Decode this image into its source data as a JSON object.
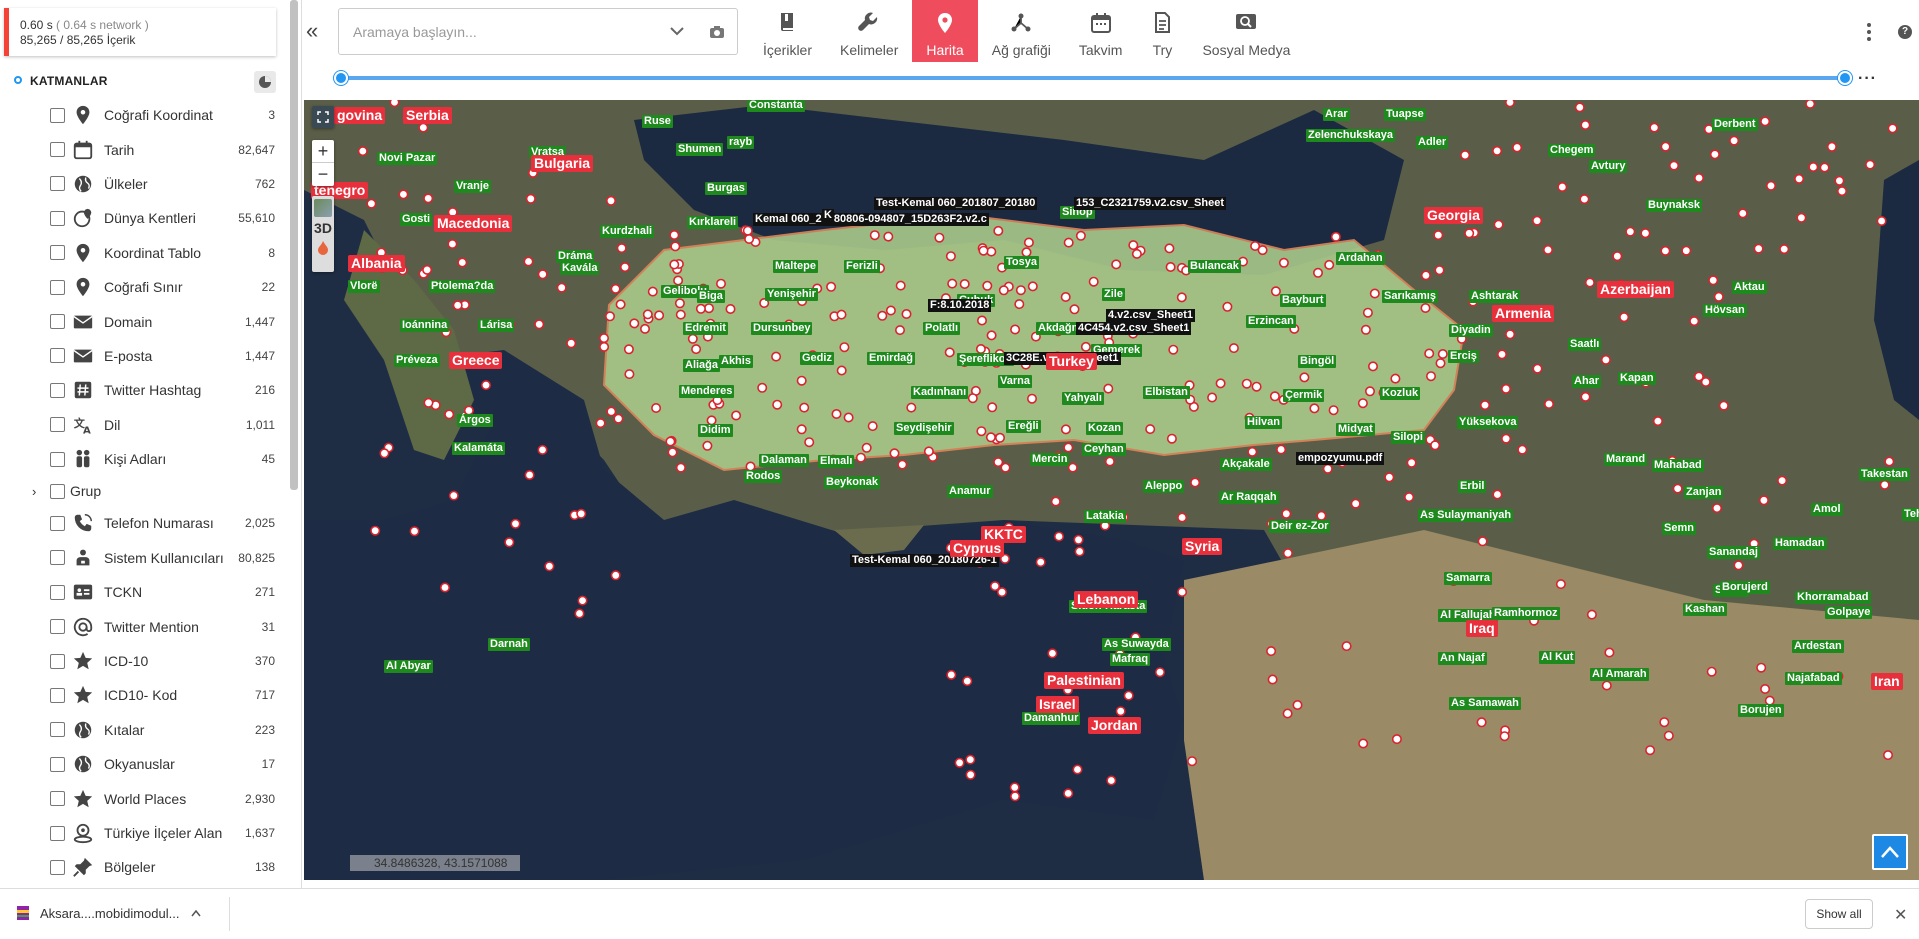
{
  "status": {
    "time": "0.60 s",
    "network": "( 0.64 s network )",
    "count": "85,265 / 85,265 İçerik"
  },
  "layers_title": "KATMANLAR",
  "layers": [
    {
      "label": "Coğrafi Koordinat",
      "count": "3",
      "icon": "pin-icon"
    },
    {
      "label": "Tarih",
      "count": "82,647",
      "icon": "calendar-icon"
    },
    {
      "label": "Ülkeler",
      "count": "762",
      "icon": "globe-icon"
    },
    {
      "label": "Dünya Kentleri",
      "count": "55,610",
      "icon": "globe-pin-icon"
    },
    {
      "label": "Koordinat Tablo",
      "count": "8",
      "icon": "pin-icon"
    },
    {
      "label": "Coğrafi Sınır",
      "count": "22",
      "icon": "pin-icon"
    },
    {
      "label": "Domain",
      "count": "1,447",
      "icon": "mail-icon"
    },
    {
      "label": "E-posta",
      "count": "1,447",
      "icon": "mail-icon"
    },
    {
      "label": "Twitter Hashtag",
      "count": "216",
      "icon": "hashtag-icon"
    },
    {
      "label": "Dil",
      "count": "1,011",
      "icon": "translate-icon"
    },
    {
      "label": "Kişi Adları",
      "count": "45",
      "icon": "people-icon"
    },
    {
      "label": "Grup",
      "count": "",
      "icon": ""
    },
    {
      "label": "Telefon Numarası",
      "count": "2,025",
      "icon": "phone-icon"
    },
    {
      "label": "Sistem Kullanıcıları",
      "count": "80,825",
      "icon": "users-icon"
    },
    {
      "label": "TCKN",
      "count": "271",
      "icon": "id-card-icon"
    },
    {
      "label": "Twitter Mention",
      "count": "31",
      "icon": "at-icon"
    },
    {
      "label": "ICD-10",
      "count": "370",
      "icon": "star-icon"
    },
    {
      "label": "ICD10- Kod",
      "count": "717",
      "icon": "star-icon"
    },
    {
      "label": "Kıtalar",
      "count": "223",
      "icon": "globe-icon"
    },
    {
      "label": "Okyanuslar",
      "count": "17",
      "icon": "globe-icon"
    },
    {
      "label": "World Places",
      "count": "2,930",
      "icon": "star-icon"
    },
    {
      "label": "Türkiye İlçeler Alan",
      "count": "1,637",
      "icon": "map-area-icon"
    },
    {
      "label": "Bölgeler",
      "count": "138",
      "icon": "pushpin-icon"
    }
  ],
  "search": {
    "placeholder": "Aramaya başlayın..."
  },
  "tabs": [
    {
      "label": "İçerikler",
      "icon": "book-icon",
      "active": false
    },
    {
      "label": "Kelimeler",
      "icon": "wrench-icon",
      "active": false
    },
    {
      "label": "Harita",
      "icon": "map-pin-icon",
      "active": true
    },
    {
      "label": "Ağ grafiği",
      "icon": "network-icon",
      "active": false
    },
    {
      "label": "Takvim",
      "icon": "calendar-icon",
      "active": false
    },
    {
      "label": "Try",
      "icon": "document-icon",
      "active": false
    },
    {
      "label": "Sosyal Medya",
      "icon": "image-search-icon",
      "active": false
    }
  ],
  "map": {
    "coordinates": "34.8486328, 43.1571088",
    "map_3d_label": "3D",
    "countries": [
      {
        "t": "Serbia"
      },
      {
        "t": "Bulgaria"
      },
      {
        "t": "tenegro"
      },
      {
        "t": "Macedonia"
      },
      {
        "t": "Albania"
      },
      {
        "t": "Greece"
      },
      {
        "t": "Georgia"
      },
      {
        "t": "Azerbaijan"
      },
      {
        "t": "Armenia"
      },
      {
        "t": "Turkey"
      },
      {
        "t": "KKTC"
      },
      {
        "t": "Cyprus"
      },
      {
        "t": "Syria"
      },
      {
        "t": "Lebanon"
      },
      {
        "t": "Palestinian"
      },
      {
        "t": "Israel"
      },
      {
        "t": "Jordan"
      },
      {
        "t": "Iraq"
      },
      {
        "t": "Iran"
      },
      {
        "t": "govina"
      }
    ],
    "cities": [
      {
        "t": "Constanta"
      },
      {
        "t": "Ruse"
      },
      {
        "t": "Novi Pazar"
      },
      {
        "t": "Vratsa"
      },
      {
        "t": "Shumen"
      },
      {
        "t": "Burgas"
      },
      {
        "t": "Vranje"
      },
      {
        "t": "Gosti"
      },
      {
        "t": "Kurdzhali"
      },
      {
        "t": "Kırklareli"
      },
      {
        "t": "Dráma"
      },
      {
        "t": "Kavála"
      },
      {
        "t": "Vlorë"
      },
      {
        "t": "Ptolema?da"
      },
      {
        "t": "Maltepe"
      },
      {
        "t": "Ferizli"
      },
      {
        "t": "Tosya"
      },
      {
        "t": "Sinop"
      },
      {
        "t": "Bulancak"
      },
      {
        "t": "Ardahan"
      },
      {
        "t": "Gelibolu"
      },
      {
        "t": "Biga"
      },
      {
        "t": "Yenişehir"
      },
      {
        "t": "Çubuk"
      },
      {
        "t": "Zile"
      },
      {
        "t": "Bayburt"
      },
      {
        "t": "Sarıkamış"
      },
      {
        "t": "Ashtarak"
      },
      {
        "t": "Ioánnina"
      },
      {
        "t": "Lárisa"
      },
      {
        "t": "Edremit"
      },
      {
        "t": "Dursunbey"
      },
      {
        "t": "Polatlı"
      },
      {
        "t": "Akdağmadeni"
      },
      {
        "t": "Erzincan"
      },
      {
        "t": "Diyadin"
      },
      {
        "t": "Préveza"
      },
      {
        "t": "Akhis"
      },
      {
        "t": "Gediz"
      },
      {
        "t": "Emirdağ"
      },
      {
        "t": "Şereflikoç"
      },
      {
        "t": "Gemerek"
      },
      {
        "t": "Bingöl"
      },
      {
        "t": "Erciş"
      },
      {
        "t": "Aliağa"
      },
      {
        "t": "Kadınhanı"
      },
      {
        "t": "Yahyalı"
      },
      {
        "t": "Elbistan"
      },
      {
        "t": "Çermik"
      },
      {
        "t": "Kozluk"
      },
      {
        "t": "Menderes"
      },
      {
        "t": "Árgos"
      },
      {
        "t": "Seydişehir"
      },
      {
        "t": "Ereğli"
      },
      {
        "t": "Kozan"
      },
      {
        "t": "Hilvan"
      },
      {
        "t": "Midyat"
      },
      {
        "t": "Silopi"
      },
      {
        "t": "Yüksekova"
      },
      {
        "t": "Didim"
      },
      {
        "t": "Kalamáta"
      },
      {
        "t": "Dalaman"
      },
      {
        "t": "Elmalı"
      },
      {
        "t": "Mercin"
      },
      {
        "t": "Ceyhan"
      },
      {
        "t": "Akçakale"
      },
      {
        "t": "Rodos"
      },
      {
        "t": "Beykonak"
      },
      {
        "t": "Anamur"
      },
      {
        "t": "Aleppo"
      },
      {
        "t": "Ar Raqqah"
      },
      {
        "t": "Erbil"
      },
      {
        "t": "Latakia"
      },
      {
        "t": "Deir ez-Zor"
      },
      {
        "t": "As Sulaymaniyah"
      },
      {
        "t": "Sidon"
      },
      {
        "t": "Harasta"
      },
      {
        "t": "As Suwayda"
      },
      {
        "t": "Mafraq"
      },
      {
        "t": "Damanhur"
      },
      {
        "t": "Darnah"
      },
      {
        "t": "Al Abyar"
      },
      {
        "t": "Samarra"
      },
      {
        "t": "Al Fallujah"
      },
      {
        "t": "Al Kut"
      },
      {
        "t": "An Najaf"
      },
      {
        "t": "Al Amarah"
      },
      {
        "t": "As Samawah"
      },
      {
        "t": "Arar"
      },
      {
        "t": "Tuapse"
      },
      {
        "t": "Zelenchukskaya"
      },
      {
        "t": "Adler"
      },
      {
        "t": "Chegem"
      },
      {
        "t": "Avtury"
      },
      {
        "t": "Buynaksk"
      },
      {
        "t": "Derbent"
      },
      {
        "t": "Aktau"
      },
      {
        "t": "Hövsan"
      },
      {
        "t": "Saatlı"
      },
      {
        "t": "Kapan"
      },
      {
        "t": "Ahar"
      },
      {
        "t": "Marand"
      },
      {
        "t": "Mahabad"
      },
      {
        "t": "Zanjan"
      },
      {
        "t": "Takestan"
      },
      {
        "t": "Amol"
      },
      {
        "t": "Tehran"
      },
      {
        "t": "Semn"
      },
      {
        "t": "Sanandaj"
      },
      {
        "t": "Hamadan"
      },
      {
        "t": "Saveh"
      },
      {
        "t": "Borujerd"
      },
      {
        "t": "Kashan"
      },
      {
        "t": "Khorramabad"
      },
      {
        "t": "Golpaye"
      },
      {
        "t": "Ardestan"
      },
      {
        "t": "Najafabad"
      },
      {
        "t": "Borujen"
      },
      {
        "t": "Ramhormoz"
      },
      {
        "t": "rayb"
      },
      {
        "t": "Varna"
      },
      {
        "t": "Al"
      }
    ],
    "files": [
      {
        "t": "Test-Kemal 060_201807_20180"
      },
      {
        "t": "153_C2321759.v2.csv_Sheet"
      },
      {
        "t": "Kemal 060_20180806-094807_15D263F2.v2.c"
      },
      {
        "t": "F:8.10.2018"
      },
      {
        "t": "4.v2.csv_Sheet1"
      },
      {
        "t": "4C454.v2.csv_Sheet1"
      },
      {
        "t": "3C28E.v2.csv_Sheet1"
      },
      {
        "t": "empozyumu.pdf"
      },
      {
        "t": "Test-Kemal 060_20180726-1"
      },
      {
        "t": "K"
      }
    ]
  },
  "downloads": {
    "filename": "Aksara....mobidimodul...",
    "show_all": "Show all"
  }
}
